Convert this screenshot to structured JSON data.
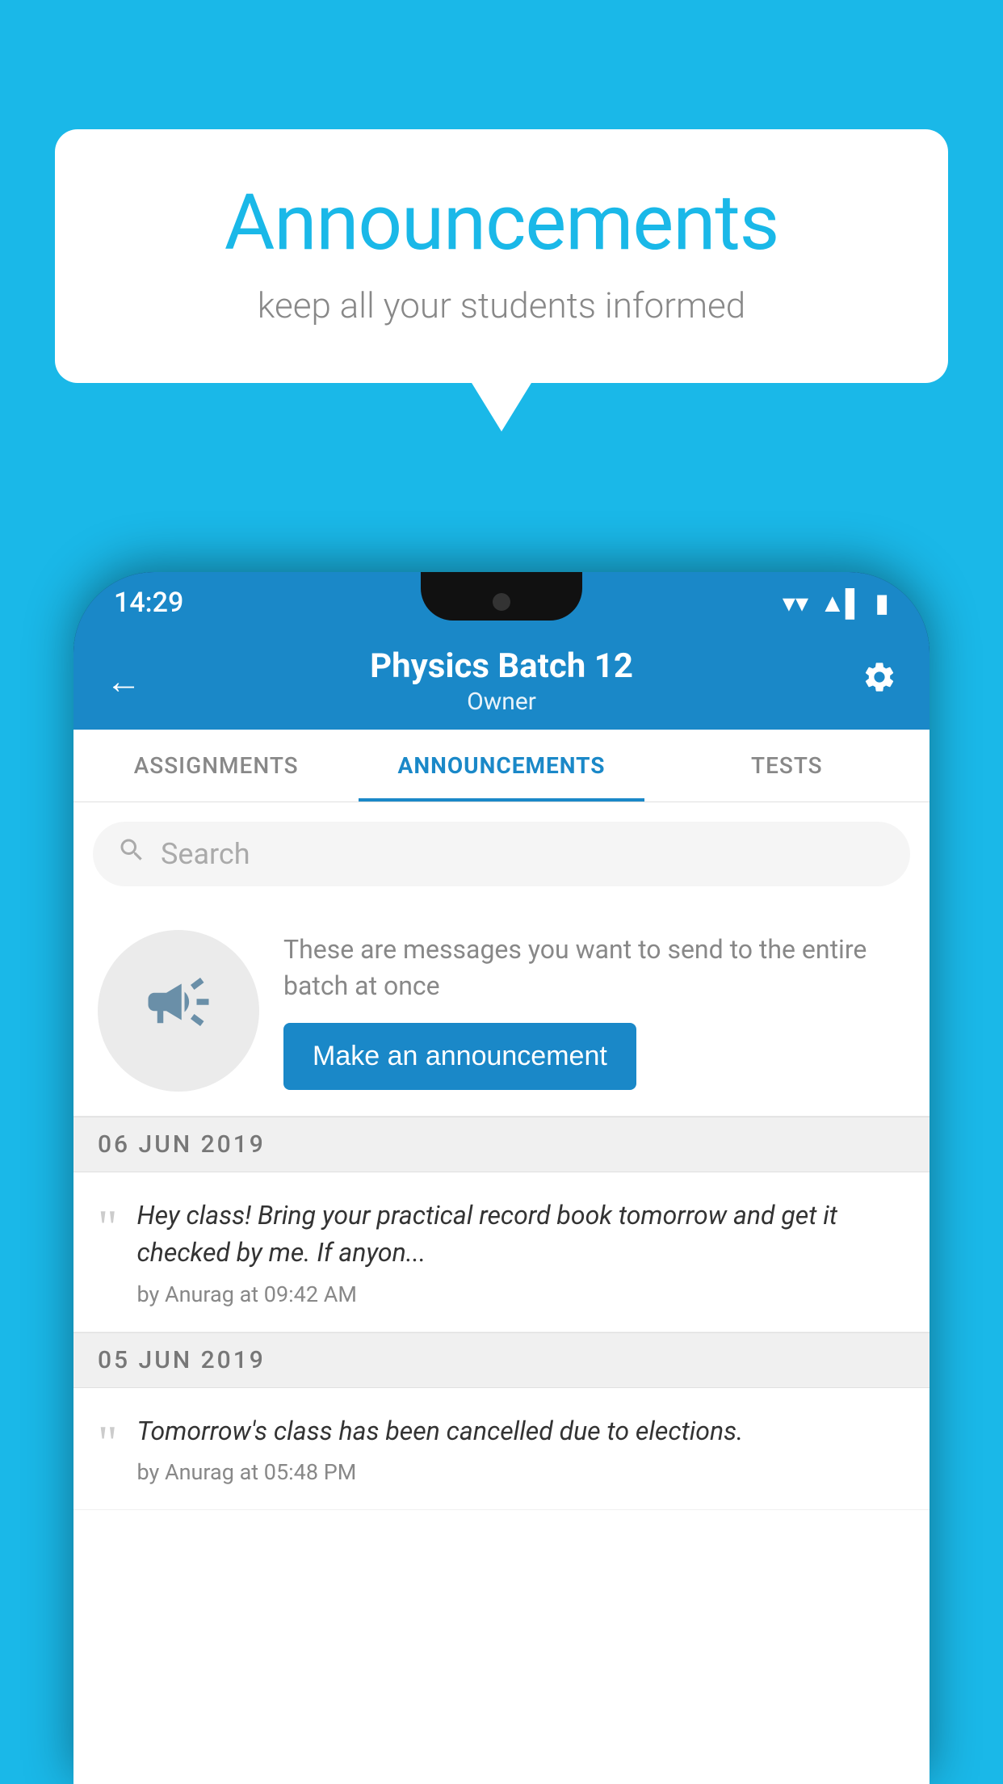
{
  "background_color": "#1ab8e8",
  "speech_bubble": {
    "title": "Announcements",
    "subtitle": "keep all your students informed"
  },
  "status_bar": {
    "time": "14:29",
    "wifi": "▲",
    "signal": "◀",
    "battery": "▌"
  },
  "app_bar": {
    "back_label": "←",
    "title": "Physics Batch 12",
    "subtitle": "Owner",
    "settings_label": "⚙"
  },
  "tabs": [
    {
      "label": "ASSIGNMENTS",
      "active": false
    },
    {
      "label": "ANNOUNCEMENTS",
      "active": true
    },
    {
      "label": "TESTS",
      "active": false
    }
  ],
  "search": {
    "placeholder": "Search"
  },
  "announcement_prompt": {
    "description": "These are messages you want to send to the entire batch at once",
    "button_label": "Make an announcement"
  },
  "announcements": [
    {
      "date": "06  JUN  2019",
      "text": "Hey class! Bring your practical record book tomorrow and get it checked by me. If anyon...",
      "meta": "by Anurag at 09:42 AM"
    },
    {
      "date": "05  JUN  2019",
      "text": "Tomorrow's class has been cancelled due to elections.",
      "meta": "by Anurag at 05:48 PM"
    }
  ],
  "icons": {
    "megaphone": "📣",
    "quote": "“",
    "search": "🔍"
  }
}
